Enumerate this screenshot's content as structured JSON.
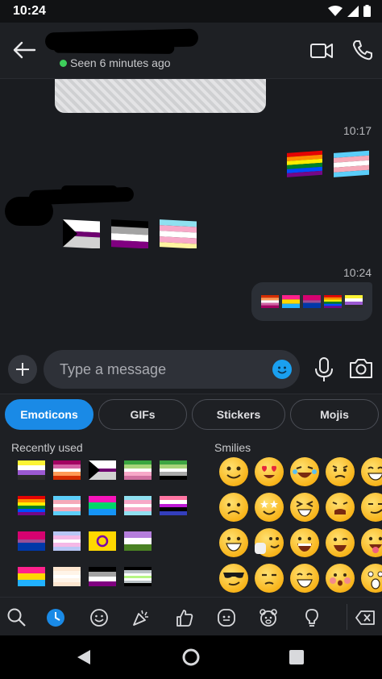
{
  "status_bar": {
    "time": "10:24"
  },
  "header": {
    "presence": "Seen 6 minutes ago"
  },
  "chat": {
    "timestamps": [
      "10:17",
      "10:24"
    ]
  },
  "input": {
    "placeholder": "Type a message"
  },
  "picker": {
    "tabs": [
      {
        "label": "Emoticons",
        "active": true
      },
      {
        "label": "GIFs",
        "active": false
      },
      {
        "label": "Stickers",
        "active": false
      },
      {
        "label": "Mojis",
        "active": false
      }
    ],
    "recent_label": "Recently used",
    "smilies_label": "Smilies"
  },
  "colors": {
    "accent": "#1a8ae6",
    "online": "#3ecf5b",
    "emoji_blue": "#1aa0f0"
  }
}
